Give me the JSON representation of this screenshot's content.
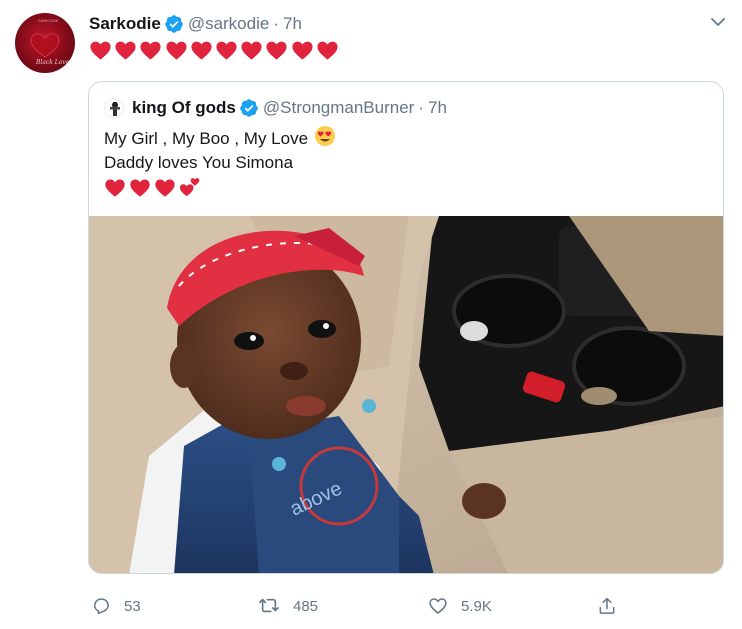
{
  "author": {
    "name": "Sarkodie",
    "handle": "@sarkodie",
    "time_sep": "·",
    "time": "7h"
  },
  "tweet": {
    "heart_count": 10
  },
  "quoted": {
    "name": "king Of gods",
    "handle": "@StrongmanBurner",
    "time_sep": "·",
    "time": "7h",
    "line1": "My Girl , My Boo , My Love",
    "line2": "Daddy loves You Simona",
    "line1_emoji": "heart-eyes-emoji",
    "hearts_icons": [
      "red-heart-icon",
      "red-heart-icon",
      "red-heart-icon",
      "two-hearts-icon"
    ]
  },
  "actions": {
    "replies": "53",
    "retweets": "485",
    "likes": "5.9K"
  },
  "colors": {
    "heart": "#e0243d",
    "verified": "#1da1f2",
    "muted": "#657786",
    "border": "#ccd6dd"
  }
}
